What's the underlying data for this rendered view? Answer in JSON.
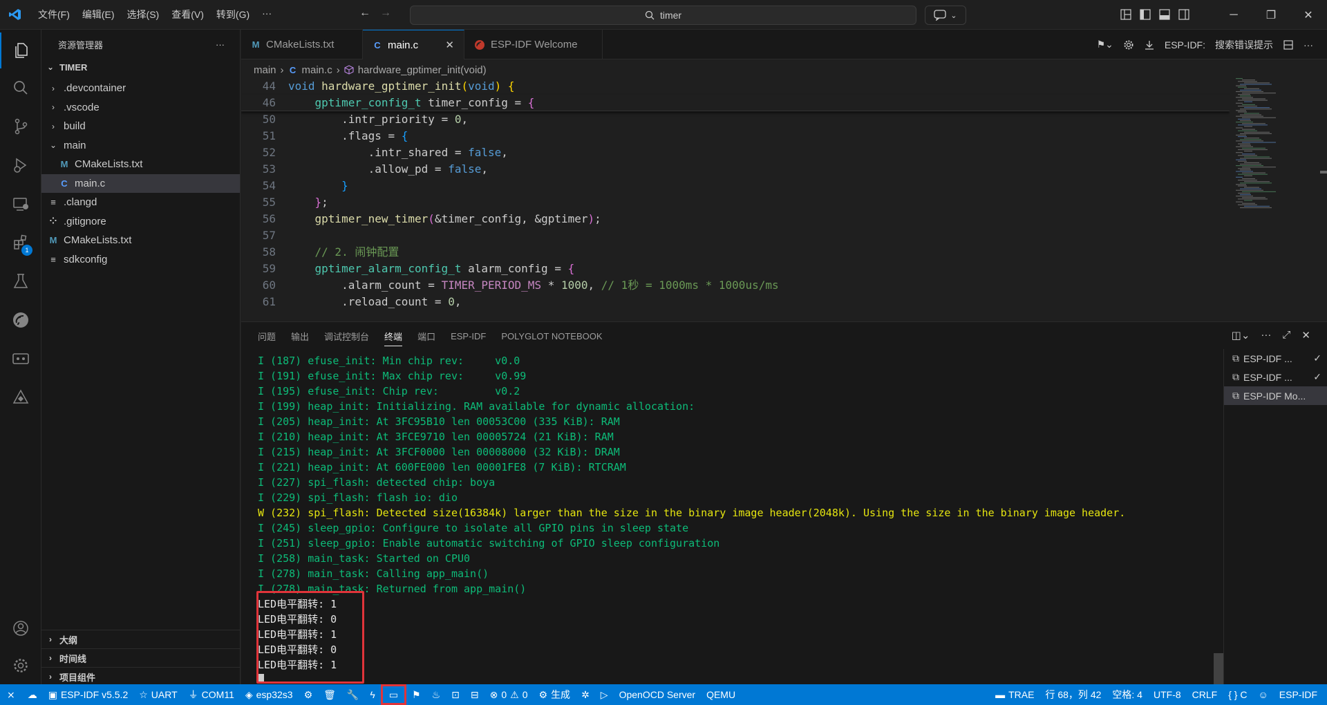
{
  "titlebar": {
    "menu": [
      "文件(F)",
      "编辑(E)",
      "选择(S)",
      "查看(V)",
      "转到(G)",
      "···"
    ],
    "search_text": "timer"
  },
  "activity_bar": {
    "items": [
      "explorer-icon",
      "search-icon",
      "source-control-icon",
      "run-debug-icon",
      "remote-explorer-icon",
      "extensions-icon",
      "testing-icon",
      "esp-idf-icon",
      "serial-monitor-icon",
      "esp-idf-explorer-icon"
    ],
    "extensions_badge": "1",
    "bottom": [
      "account-icon",
      "settings-icon"
    ]
  },
  "sidebar": {
    "title": "资源管理器",
    "more": "···",
    "root": "TIMER",
    "items": [
      {
        "label": ".devcontainer",
        "type": "folder",
        "indent": 1
      },
      {
        "label": ".vscode",
        "type": "folder",
        "indent": 1
      },
      {
        "label": "build",
        "type": "folder",
        "indent": 1
      },
      {
        "label": "main",
        "type": "folder-open",
        "indent": 1
      },
      {
        "label": "CMakeLists.txt",
        "type": "m",
        "indent": 2
      },
      {
        "label": "main.c",
        "type": "c",
        "indent": 2,
        "selected": true
      },
      {
        "label": ".clangd",
        "type": "lines",
        "indent": 1
      },
      {
        "label": ".gitignore",
        "type": "dots",
        "indent": 1
      },
      {
        "label": "CMakeLists.txt",
        "type": "m",
        "indent": 1
      },
      {
        "label": "sdkconfig",
        "type": "lines",
        "indent": 1
      }
    ],
    "sections": [
      "大纲",
      "时间线",
      "项目组件"
    ]
  },
  "tabs": [
    {
      "label": "CMakeLists.txt",
      "icon": "M"
    },
    {
      "label": "main.c",
      "icon": "C",
      "active": true
    },
    {
      "label": "ESP-IDF Welcome",
      "icon": "esp"
    }
  ],
  "tab_actions": {
    "esp_label": "ESP-IDF:",
    "esp_hint": "搜索错误提示"
  },
  "breadcrumb": {
    "folder": "main",
    "file": "main.c",
    "symbol": "hardware_gptimer_init(void)"
  },
  "code": {
    "line_numbers": [
      "44",
      "46",
      "50",
      "51",
      "52",
      "53",
      "54",
      "55",
      "56",
      "57",
      "58",
      "59",
      "60",
      "61"
    ]
  },
  "panel": {
    "tabs": [
      "问题",
      "输出",
      "调试控制台",
      "终端",
      "端口",
      "ESP-IDF",
      "POLYGLOT NOTEBOOK"
    ],
    "active_tab": "终端",
    "terminal_lines": [
      "I (187) efuse_init: Min chip rev:     v0.0",
      "I (191) efuse_init: Max chip rev:     v0.99",
      "I (195) efuse_init: Chip rev:         v0.2",
      "I (199) heap_init: Initializing. RAM available for dynamic allocation:",
      "I (205) heap_init: At 3FC95B10 len 00053C00 (335 KiB): RAM",
      "I (210) heap_init: At 3FCE9710 len 00005724 (21 KiB): RAM",
      "I (215) heap_init: At 3FCF0000 len 00008000 (32 KiB): DRAM",
      "I (221) heap_init: At 600FE000 len 00001FE8 (7 KiB): RTCRAM",
      "I (227) spi_flash: detected chip: boya",
      "I (229) spi_flash: flash io: dio",
      "W (232) spi_flash: Detected size(16384k) larger than the size in the binary image header(2048k). Using the size in the binary image header.",
      "I (245) sleep_gpio: Configure to isolate all GPIO pins in sleep state",
      "I (251) sleep_gpio: Enable automatic switching of GPIO sleep configuration",
      "I (258) main_task: Started on CPU0",
      "I (278) main_task: Calling app_main()",
      "I (278) main_task: Returned from app_main()"
    ],
    "led_lines": [
      "LED电平翻转: 1",
      "LED电平翻转: 0",
      "LED电平翻转: 1",
      "LED电平翻转: 0",
      "LED电平翻转: 1"
    ],
    "terminals": [
      "ESP-IDF ...",
      "ESP-IDF ...",
      "ESP-IDF Mo..."
    ]
  },
  "statusbar": {
    "left": [
      "ESP-IDF v5.5.2",
      "UART",
      "COM11",
      "esp32s3"
    ],
    "errors": "0",
    "warnings": "0",
    "build": "生成",
    "openocd": "OpenOCD Server",
    "qemu": "QEMU",
    "right": [
      "TRAE",
      "行 68，列 42",
      "空格: 4",
      "UTF-8",
      "CRLF",
      "{ } C",
      "ESP-IDF"
    ]
  },
  "colors": {
    "accent": "#0078d4",
    "terminal_green": "#0dbc79",
    "terminal_warn": "#e5e510",
    "highlight_red": "#e0343a"
  }
}
